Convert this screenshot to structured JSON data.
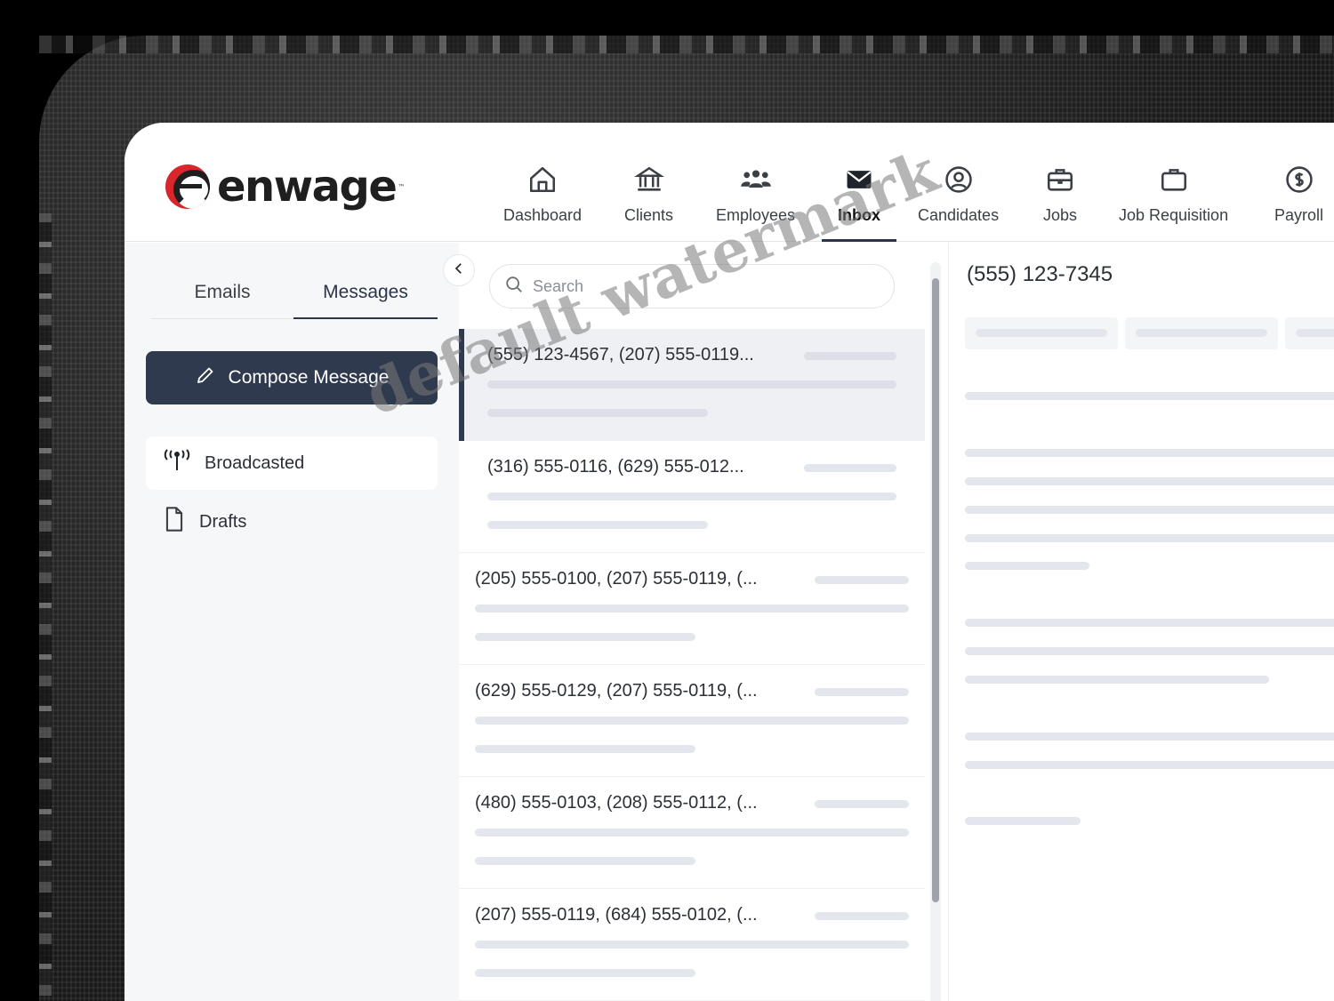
{
  "brand": {
    "name": "enwage",
    "tm": "™"
  },
  "nav": {
    "items": [
      {
        "label": "Dashboard",
        "icon": "home-icon"
      },
      {
        "label": "Clients",
        "icon": "bank-icon"
      },
      {
        "label": "Employees",
        "icon": "people-icon"
      },
      {
        "label": "Inbox",
        "icon": "envelope-icon",
        "active": true
      },
      {
        "label": "Candidates",
        "icon": "user-circle-icon"
      },
      {
        "label": "Jobs",
        "icon": "briefcase-icon"
      },
      {
        "label": "Job Requisition",
        "icon": "bag-icon"
      },
      {
        "label": "Payroll",
        "icon": "dollar-circle-icon"
      }
    ]
  },
  "sidebar": {
    "tabs": [
      {
        "label": "Emails"
      },
      {
        "label": "Messages",
        "active": true
      }
    ],
    "compose_label": "Compose Message",
    "folders": [
      {
        "label": "Broadcasted",
        "icon": "broadcast-icon",
        "selected": true
      },
      {
        "label": "Drafts",
        "icon": "document-icon"
      }
    ]
  },
  "list": {
    "search_placeholder": "Search",
    "messages": [
      {
        "title": "(555) 123-4567, (207) 555-0119...",
        "selected": true
      },
      {
        "title": "(316) 555-0116, (629) 555-012..."
      },
      {
        "title": "(205) 555-0100, (207) 555-0119, (..."
      },
      {
        "title": "(629) 555-0129, (207) 555-0119, (..."
      },
      {
        "title": "(480) 555-0103, (208) 555-0112, (..."
      },
      {
        "title": "(207) 555-0119, (684) 555-0102, (..."
      }
    ]
  },
  "detail": {
    "title": "(555) 123-7345"
  },
  "watermark": "default watermark",
  "colors": {
    "primary": "#2f3a4e",
    "brand_red": "#d8262c",
    "skeleton": "#e3e6ec"
  }
}
